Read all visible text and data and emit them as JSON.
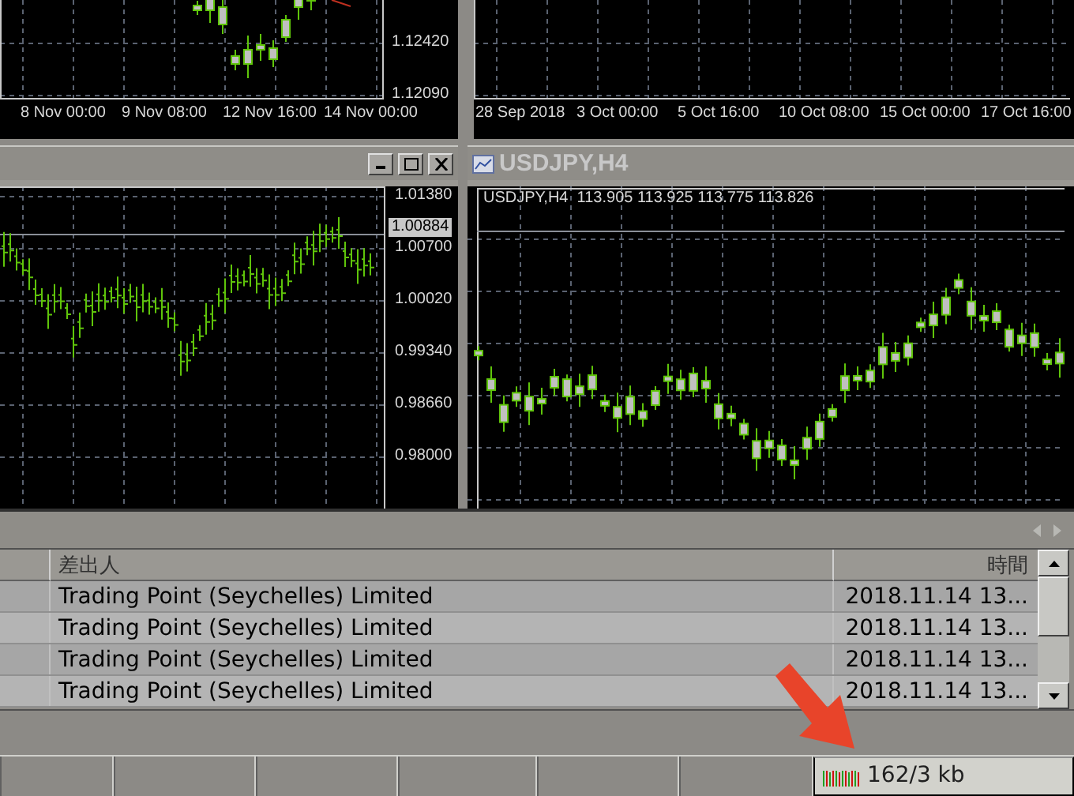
{
  "top_charts": [
    {
      "price_labels": [
        "1.12420",
        "1.12090"
      ],
      "time_labels": [
        "8 Nov 00:00",
        "9 Nov 08:00",
        "12 Nov 16:00",
        "14 Nov 00:00"
      ]
    },
    {
      "time_labels": [
        "28 Sep 2018",
        "3 Oct 00:00",
        "5 Oct 16:00",
        "10 Oct 08:00",
        "15 Oct 00:00",
        "17 Oct 16:00"
      ]
    }
  ],
  "windows": [
    {
      "kind": "bars",
      "price_labels": [
        "1.01380",
        "1.00700",
        "1.00020",
        "0.99340",
        "0.98660",
        "0.98000"
      ],
      "current_price": "1.00884"
    },
    {
      "kind": "candles",
      "title": "USDJPY,H4",
      "info": "USDJPY,H4  113.905 113.925 113.775 113.826"
    }
  ],
  "terminal": {
    "columns": [
      "差出人",
      "時間"
    ],
    "rows": [
      {
        "sender": "Trading Point (Seychelles) Limited",
        "time": "2018.11.14 13..."
      },
      {
        "sender": "Trading Point (Seychelles) Limited",
        "time": "2018.11.14 13..."
      },
      {
        "sender": "Trading Point (Seychelles) Limited",
        "time": "2018.11.14 13..."
      },
      {
        "sender": "Trading Point (Seychelles) Limited",
        "time": "2018.11.14 13..."
      }
    ]
  },
  "status_bar": {
    "traffic": "162/3 kb"
  }
}
